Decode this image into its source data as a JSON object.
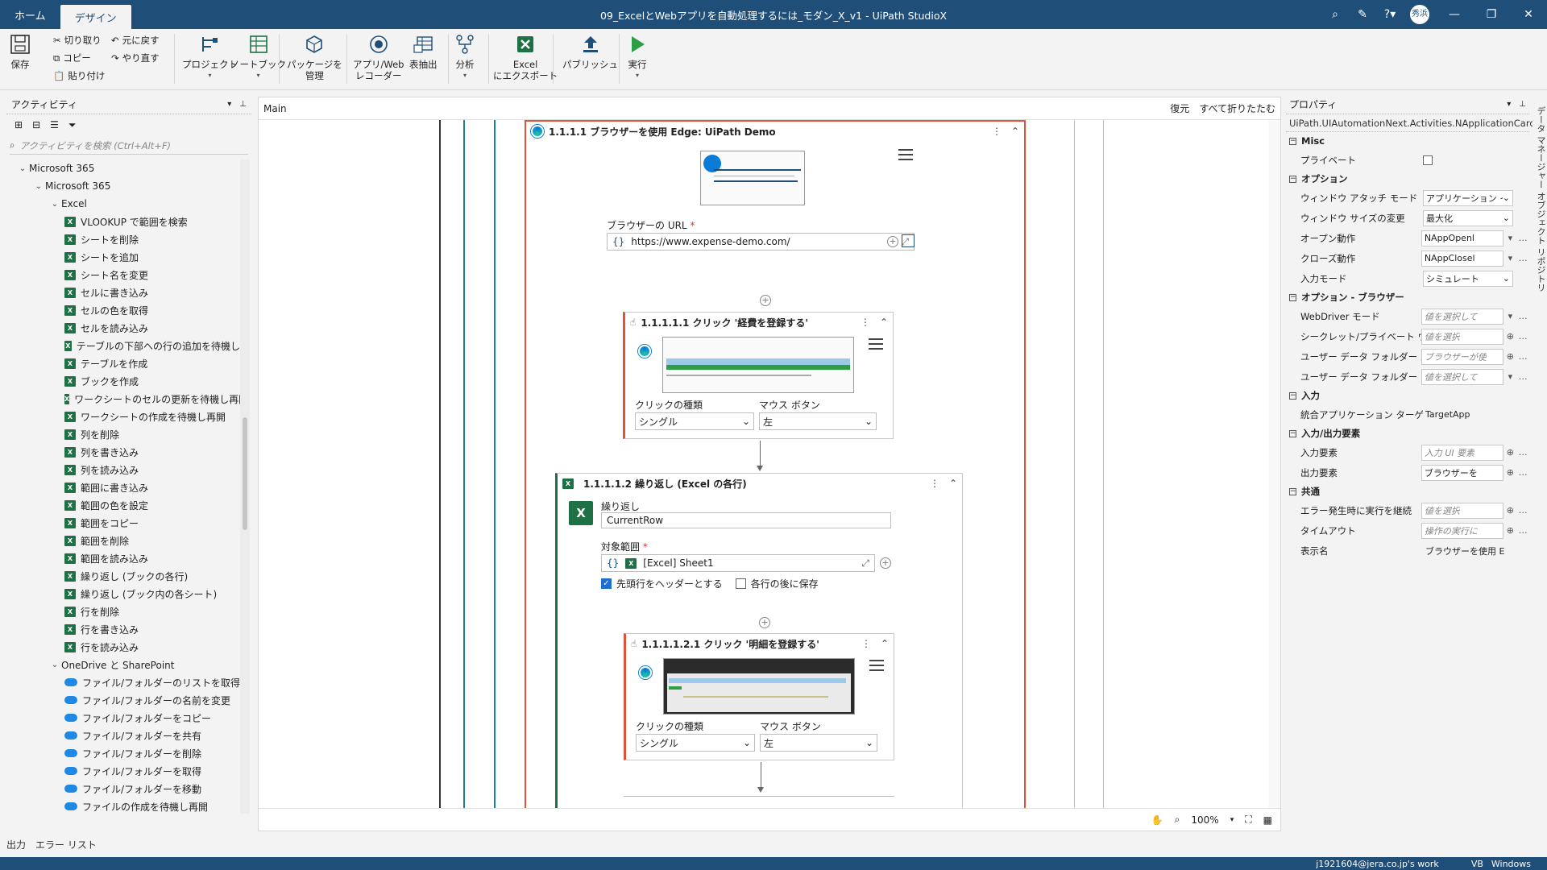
{
  "titlebar": {
    "tabs": [
      "ホーム",
      "デザイン"
    ],
    "title": "09_ExcelとWebアプリを自動処理するには_モダン_X_v1 - UiPath StudioX",
    "avatar": "秀浜"
  },
  "ribbon": {
    "save": "保存",
    "cut": "切り取り",
    "copy": "コピー",
    "paste": "貼り付け",
    "undo": "元に戻す",
    "redo": "やり直す",
    "project": "プロジェクト",
    "notebook": "ノートブック",
    "packages": [
      "パッケージを",
      "管理"
    ],
    "recorder": [
      "アプリ/Web",
      "レコーダー"
    ],
    "table_extract": "表抽出",
    "analyze": "分析",
    "excel_export": [
      "Excel",
      "にエクスポート"
    ],
    "publish": "パブリッシュ",
    "run": "実行"
  },
  "activities": {
    "title": "アクティビティ",
    "search_placeholder": "アクティビティを検索 (Ctrl+Alt+F)",
    "tree": [
      {
        "label": "Microsoft 365",
        "level": 0,
        "type": "group"
      },
      {
        "label": "Microsoft 365",
        "level": 1,
        "type": "group"
      },
      {
        "label": "Excel",
        "level": 2,
        "type": "group"
      },
      {
        "label": "VLOOKUP で範囲を検索",
        "level": 3,
        "type": "excel"
      },
      {
        "label": "シートを削除",
        "level": 3,
        "type": "excel"
      },
      {
        "label": "シートを追加",
        "level": 3,
        "type": "excel"
      },
      {
        "label": "シート名を変更",
        "level": 3,
        "type": "excel"
      },
      {
        "label": "セルに書き込み",
        "level": 3,
        "type": "excel"
      },
      {
        "label": "セルの色を取得",
        "level": 3,
        "type": "excel"
      },
      {
        "label": "セルを読み込み",
        "level": 3,
        "type": "excel"
      },
      {
        "label": "テーブルの下部への行の追加を待機し",
        "level": 3,
        "type": "excel"
      },
      {
        "label": "テーブルを作成",
        "level": 3,
        "type": "excel"
      },
      {
        "label": "ブックを作成",
        "level": 3,
        "type": "excel"
      },
      {
        "label": "ワークシートのセルの更新を待機し再開",
        "level": 3,
        "type": "excel"
      },
      {
        "label": "ワークシートの作成を待機し再開",
        "level": 3,
        "type": "excel"
      },
      {
        "label": "列を削除",
        "level": 3,
        "type": "excel"
      },
      {
        "label": "列を書き込み",
        "level": 3,
        "type": "excel"
      },
      {
        "label": "列を読み込み",
        "level": 3,
        "type": "excel"
      },
      {
        "label": "範囲に書き込み",
        "level": 3,
        "type": "excel"
      },
      {
        "label": "範囲の色を設定",
        "level": 3,
        "type": "excel"
      },
      {
        "label": "範囲をコピー",
        "level": 3,
        "type": "excel"
      },
      {
        "label": "範囲を削除",
        "level": 3,
        "type": "excel"
      },
      {
        "label": "範囲を読み込み",
        "level": 3,
        "type": "excel"
      },
      {
        "label": "繰り返し (ブックの各行)",
        "level": 3,
        "type": "excel"
      },
      {
        "label": "繰り返し (ブック内の各シート)",
        "level": 3,
        "type": "excel"
      },
      {
        "label": "行を削除",
        "level": 3,
        "type": "excel"
      },
      {
        "label": "行を書き込み",
        "level": 3,
        "type": "excel"
      },
      {
        "label": "行を読み込み",
        "level": 3,
        "type": "excel"
      },
      {
        "label": "OneDrive と SharePoint",
        "level": 2,
        "type": "group"
      },
      {
        "label": "ファイル/フォルダーのリストを取得",
        "level": 3,
        "type": "onedrive"
      },
      {
        "label": "ファイル/フォルダーの名前を変更",
        "level": 3,
        "type": "onedrive"
      },
      {
        "label": "ファイル/フォルダーをコピー",
        "level": 3,
        "type": "onedrive"
      },
      {
        "label": "ファイル/フォルダーを共有",
        "level": 3,
        "type": "onedrive"
      },
      {
        "label": "ファイル/フォルダーを削除",
        "level": 3,
        "type": "onedrive"
      },
      {
        "label": "ファイル/フォルダーを取得",
        "level": 3,
        "type": "onedrive"
      },
      {
        "label": "ファイル/フォルダーを移動",
        "level": 3,
        "type": "onedrive"
      },
      {
        "label": "ファイルの作成を待機し再開",
        "level": 3,
        "type": "onedrive"
      }
    ]
  },
  "designer": {
    "tab": "Main",
    "restore": "復元",
    "collapse_all": "すべて折りたたむ",
    "zoom": "100%",
    "use_browser": {
      "title": "1.1.1.1  ブラウザーを使用 Edge: UiPath Demo",
      "url_label": "ブラウザーの URL",
      "url": "https://www.expense-demo.com/"
    },
    "click1": {
      "title": "1.1.1.1.1  クリック '経費を登録する'",
      "click_type_label": "クリックの種類",
      "click_type": "シングル",
      "mouse_label": "マウス ボタン",
      "mouse": "左"
    },
    "foreach": {
      "title": "1.1.1.1.2  繰り返し (Excel の各行)",
      "repeat_label": "繰り返し",
      "repeat_value": "CurrentRow",
      "range_label": "対象範囲",
      "range_value": "[Excel] Sheet1",
      "header_check": "先頭行をヘッダーとする",
      "save_check": "各行の後に保存"
    },
    "click2": {
      "title": "1.1.1.1.2.1  クリック '明細を登録する'",
      "click_type_label": "クリックの種類",
      "click_type": "シングル",
      "mouse_label": "マウス ボタン",
      "mouse": "左"
    }
  },
  "properties": {
    "title": "プロパティ",
    "class": "UiPath.UIAutomationNext.Activities.NApplicationCard",
    "rows": [
      {
        "kind": "sec",
        "label": "Misc"
      },
      {
        "kind": "check",
        "label": "プライベート"
      },
      {
        "kind": "sec",
        "label": "オプション"
      },
      {
        "kind": "select",
        "label": "ウィンドウ アタッチ モード",
        "value": "アプリケーション イン"
      },
      {
        "kind": "select",
        "label": "ウィンドウ サイズの変更",
        "value": "最大化"
      },
      {
        "kind": "drop",
        "label": "オープン動作",
        "value": "NAppOpenl"
      },
      {
        "kind": "drop",
        "label": "クローズ動作",
        "value": "NAppClosel"
      },
      {
        "kind": "select",
        "label": "入力モード",
        "value": "シミュレート"
      },
      {
        "kind": "sec",
        "label": "オプション - ブラウザー"
      },
      {
        "kind": "dropph",
        "label": "WebDriver モード",
        "value": "値を選択して"
      },
      {
        "kind": "plusph",
        "label": "シークレット/プライベート ウィンドウ",
        "value": "値を選択"
      },
      {
        "kind": "plusph",
        "label": "ユーザー データ フォルダー パス",
        "value": "ブラウザーが使"
      },
      {
        "kind": "dropph",
        "label": "ユーザー データ フォルダー モード",
        "value": "値を選択して"
      },
      {
        "kind": "sec",
        "label": "入力"
      },
      {
        "kind": "text",
        "label": "統合アプリケーション ターゲット",
        "value": "TargetApp"
      },
      {
        "kind": "sec",
        "label": "入力/出力要素"
      },
      {
        "kind": "plusph",
        "label": "入力要素",
        "value": "入力 UI 要素"
      },
      {
        "kind": "plus",
        "label": "出力要素",
        "value": "ブラウザーを"
      },
      {
        "kind": "sec",
        "label": "共通"
      },
      {
        "kind": "plusph",
        "label": "エラー発生時に実行を継続",
        "value": "値を選択"
      },
      {
        "kind": "plusph",
        "label": "タイムアウト",
        "value": "操作の実行に"
      },
      {
        "kind": "text",
        "label": "表示名",
        "value": "ブラウザーを使用 Edge:"
      }
    ]
  },
  "right_strip": "データ マネージャー   オブジェクト リポジトリ",
  "bottom": {
    "output": "出力",
    "errors": "エラー リスト"
  },
  "status": {
    "account": "j1921604@jera.co.jp's work",
    "lang": "VB",
    "os": "Windows"
  }
}
